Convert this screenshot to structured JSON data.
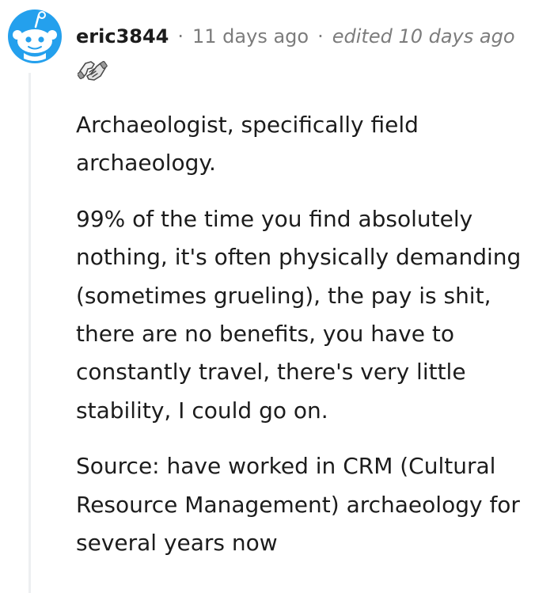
{
  "comment": {
    "author": "eric3844",
    "separator": "·",
    "timestamp": "11 days ago",
    "edited": "edited 10 days ago",
    "avatar_icon": "snoo-avatar-icon",
    "award_icon": "handshake-award-icon",
    "paragraphs": [
      "Archaeologist, specifically field archaeology.",
      "99% of the time you find absolutely nothing, it's often physically demanding (sometimes grueling), the pay is shit, there are no benefits, you have to constantly travel, there's very little stability, I could go on.",
      "Source: have worked in CRM (Cultural Resource Management) archaeology for several years now"
    ]
  },
  "colors": {
    "avatar_blue": "#24a0ed",
    "text": "#1c1c1c",
    "meta": "#7c7c7c",
    "thread_line": "#edeff1"
  }
}
